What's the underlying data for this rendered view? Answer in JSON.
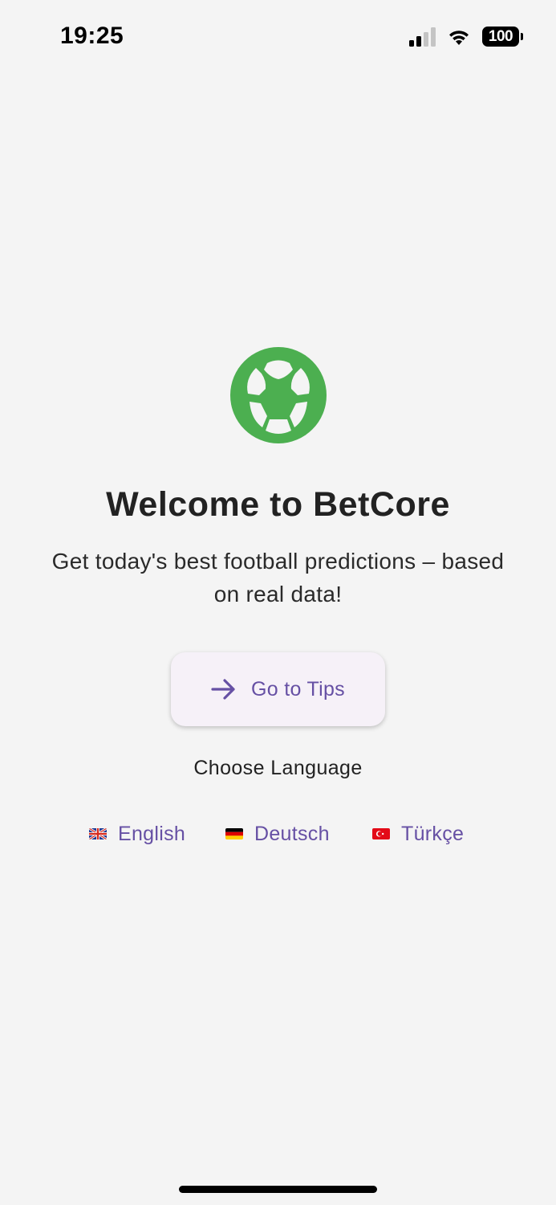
{
  "status_bar": {
    "time": "19:25",
    "battery": "100"
  },
  "welcome": {
    "title": "Welcome to BetCore",
    "subtitle": "Get today's best football predictions – based on real data!"
  },
  "cta": {
    "label": "Go to Tips",
    "icon": "arrow-right-icon"
  },
  "language": {
    "heading": "Choose Language",
    "options": [
      {
        "flag": "uk-flag-icon",
        "label": "English"
      },
      {
        "flag": "germany-flag-icon",
        "label": "Deutsch"
      },
      {
        "flag": "turkey-flag-icon",
        "label": "Türkçe"
      }
    ]
  },
  "colors": {
    "accent": "#6650a4",
    "logo_green": "#4caf50",
    "background": "#f4f4f4",
    "button_bg": "#f6f1f8"
  }
}
